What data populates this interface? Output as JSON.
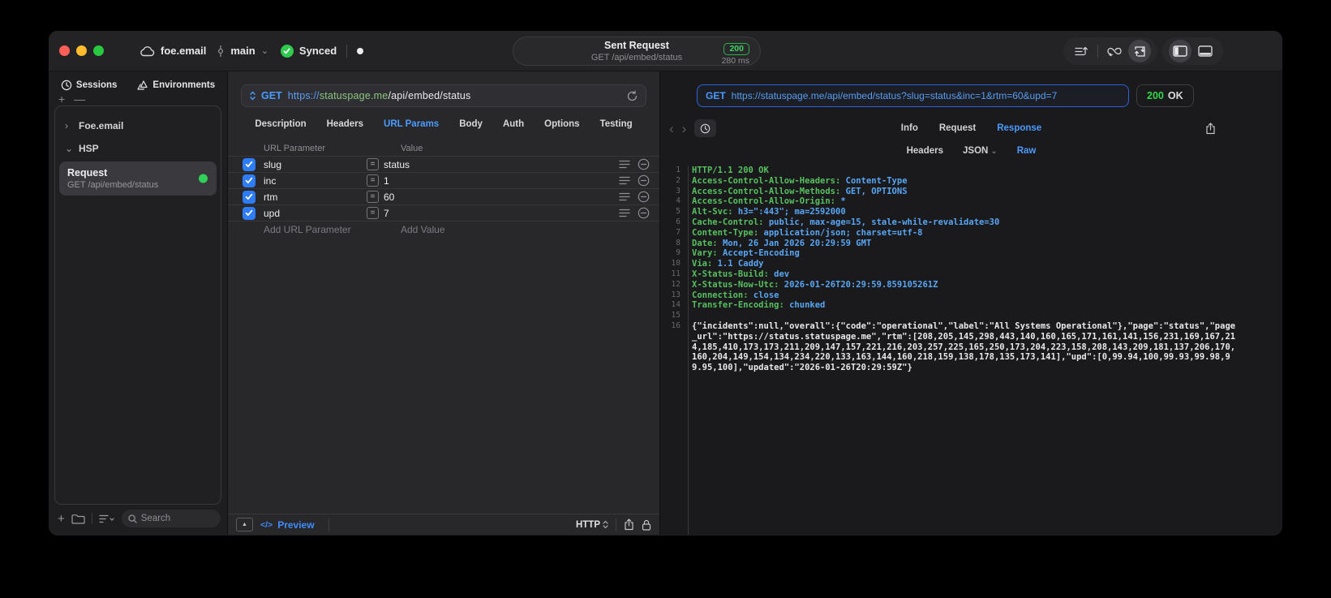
{
  "titlebar": {
    "project": "foe.email",
    "branch": "main",
    "sync_status": "Synced",
    "request_summary": {
      "title": "Sent Request",
      "subtitle": "GET /api/embed/status",
      "status_code": "200",
      "duration": "280 ms"
    }
  },
  "sidebar": {
    "tabs": [
      {
        "label": "Sessions"
      },
      {
        "label": "Environments"
      }
    ],
    "tree": [
      {
        "label": "Foe.email",
        "expanded": false
      },
      {
        "label": "HSP",
        "expanded": true
      }
    ],
    "request_item": {
      "title": "Request",
      "subtitle": "GET /api/embed/status"
    },
    "search_placeholder": "Search"
  },
  "request_panel": {
    "method": "GET",
    "url_scheme": "https://",
    "url_host": "statuspage.me",
    "url_path": "/api/embed/status",
    "tabs": [
      "Description",
      "Headers",
      "URL Params",
      "Body",
      "Auth",
      "Options",
      "Testing"
    ],
    "active_tab": "URL Params",
    "param_table": {
      "columns": [
        "URL Parameter",
        "Value"
      ],
      "rows": [
        {
          "name": "slug",
          "value": "status",
          "enabled": true
        },
        {
          "name": "inc",
          "value": "1",
          "enabled": true
        },
        {
          "name": "rtm",
          "value": "60",
          "enabled": true
        },
        {
          "name": "upd",
          "value": "7",
          "enabled": true
        }
      ],
      "add_parameter_placeholder": "Add URL Parameter",
      "add_value_placeholder": "Add Value"
    },
    "footer": {
      "code_glyph": "</>",
      "preview_label": "Preview",
      "protocol": "HTTP"
    }
  },
  "response_panel": {
    "request_line": {
      "method": "GET",
      "url": "https://statuspage.me/api/embed/status?slug=status&inc=1&rtm=60&upd=7"
    },
    "status": {
      "code": "200",
      "text": "OK"
    },
    "tabs": [
      "Info",
      "Request",
      "Response"
    ],
    "active_tab": "Response",
    "subtabs": [
      {
        "label": "Headers"
      },
      {
        "label": "JSON",
        "dropdown": true
      },
      {
        "label": "Raw"
      }
    ],
    "active_subtab": "Raw",
    "body": {
      "status_line": "HTTP/1.1 200 OK",
      "headers": [
        {
          "name": "Access-Control-Allow-Headers",
          "value": "Content-Type"
        },
        {
          "name": "Access-Control-Allow-Methods",
          "value": "GET, OPTIONS"
        },
        {
          "name": "Access-Control-Allow-Origin",
          "value": "*"
        },
        {
          "name": "Alt-Svc",
          "value": "h3=\":443\"; ma=2592000"
        },
        {
          "name": "Cache-Control",
          "value": "public, max-age=15, stale-while-revalidate=30"
        },
        {
          "name": "Content-Type",
          "value": "application/json; charset=utf-8"
        },
        {
          "name": "Date",
          "value": "Mon, 26 Jan 2026 20:29:59 GMT"
        },
        {
          "name": "Vary",
          "value": "Accept-Encoding"
        },
        {
          "name": "Via",
          "value": "1.1 Caddy"
        },
        {
          "name": "X-Status-Build",
          "value": "dev"
        },
        {
          "name": "X-Status-Now-Utc",
          "value": "2026-01-26T20:29:59.859105261Z"
        },
        {
          "name": "Connection",
          "value": "close"
        },
        {
          "name": "Transfer-Encoding",
          "value": "chunked"
        }
      ],
      "json_body": "{\"incidents\":null,\"overall\":{\"code\":\"operational\",\"label\":\"All Systems Operational\"},\"page\":\"status\",\"page_url\":\"https://status.statuspage.me\",\"rtm\":[208,205,145,298,443,140,160,165,171,161,141,156,231,169,167,214,185,410,173,173,211,209,147,157,221,216,203,257,225,165,250,173,204,223,158,208,143,209,181,137,206,170,160,204,149,154,134,234,220,133,163,144,160,218,159,138,178,135,173,141],\"upd\":[0,99.94,100,99.93,99.98,99.95,100],\"updated\":\"2026-01-26T20:29:59Z\"}"
    }
  },
  "colors": {
    "accent_blue": "#4b9bff",
    "success_green": "#32d74b",
    "header_name_green": "#56c05f",
    "header_value_blue": "#58a6f5"
  }
}
